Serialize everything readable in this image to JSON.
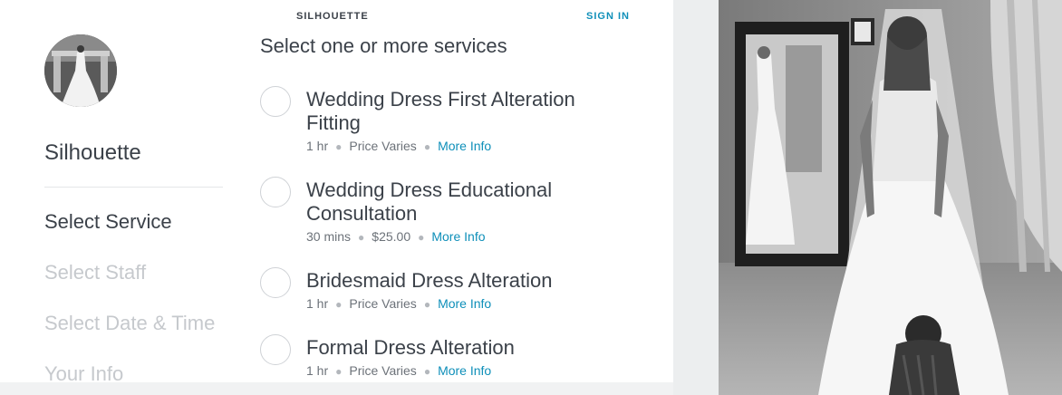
{
  "header": {
    "business_name": "SILHOUETTE",
    "sign_in": "SIGN IN"
  },
  "sidebar": {
    "business_name": "Silhouette",
    "steps": [
      {
        "label": "Select Service",
        "active": true
      },
      {
        "label": "Select Staff",
        "active": false
      },
      {
        "label": "Select Date & Time",
        "active": false
      },
      {
        "label": "Your Info",
        "active": false
      }
    ]
  },
  "main": {
    "title": "Select one or more services",
    "services": [
      {
        "name": "Wedding Dress First Alteration Fitting",
        "duration": "1 hr",
        "price": "Price Varies",
        "more": "More Info"
      },
      {
        "name": "Wedding Dress Educational Consultation",
        "duration": "30 mins",
        "price": "$25.00",
        "more": "More Info"
      },
      {
        "name": "Bridesmaid Dress Alteration",
        "duration": "1 hr",
        "price": "Price Varies",
        "more": "More Info"
      },
      {
        "name": "Formal Dress Alteration",
        "duration": "1 hr",
        "price": "Price Varies",
        "more": "More Info"
      }
    ]
  },
  "colors": {
    "accent": "#0e8fb9",
    "text": "#3b4149",
    "muted": "#c6c9cd"
  }
}
